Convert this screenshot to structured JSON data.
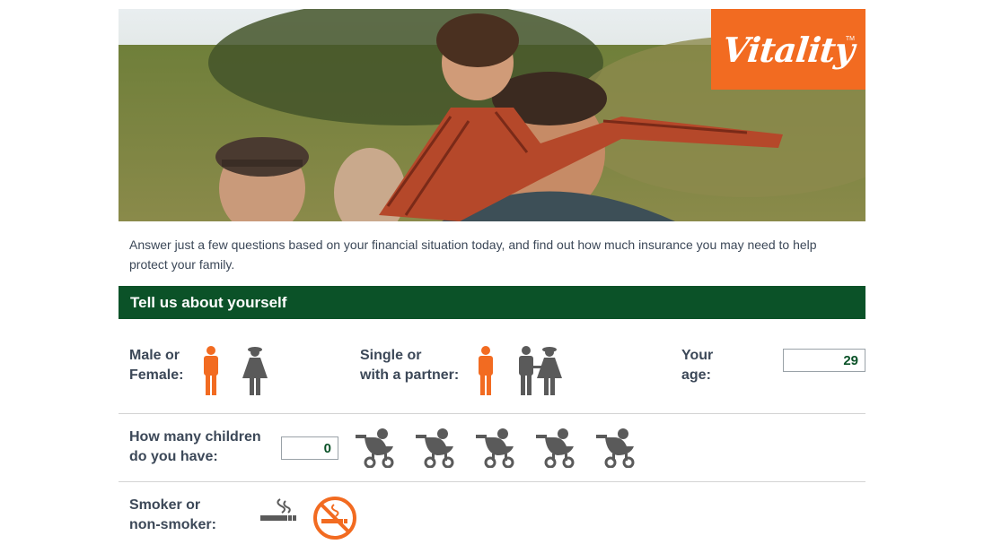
{
  "brand": {
    "logo_text": "Vitality",
    "logo_tm": "TM"
  },
  "intro": "Answer just a few questions based on your financial situation today, and find out how much insurance you may need to help protect your family.",
  "section": {
    "title": "Tell us about yourself"
  },
  "gender": {
    "label_line1": "Male or",
    "label_line2": "Female:",
    "selected": "male"
  },
  "relationship": {
    "label_line1": "Single or",
    "label_line2": "with a partner:",
    "selected": "single"
  },
  "age": {
    "label_line1": "Your",
    "label_line2": "age:",
    "value": "29"
  },
  "children": {
    "label_line1": "How many children",
    "label_line2": "do you have:",
    "value": "0"
  },
  "smoker": {
    "label_line1": "Smoker or",
    "label_line2": "non-smoker:",
    "selected": "non-smoker"
  },
  "colors": {
    "accent": "#f26b21",
    "brand_green": "#0b5228",
    "icon_gray": "#5a5a5a"
  },
  "icons": [
    "male-icon",
    "female-icon",
    "single-person-icon",
    "couple-icon",
    "stroller-icon",
    "smoking-icon",
    "no-smoking-icon"
  ]
}
